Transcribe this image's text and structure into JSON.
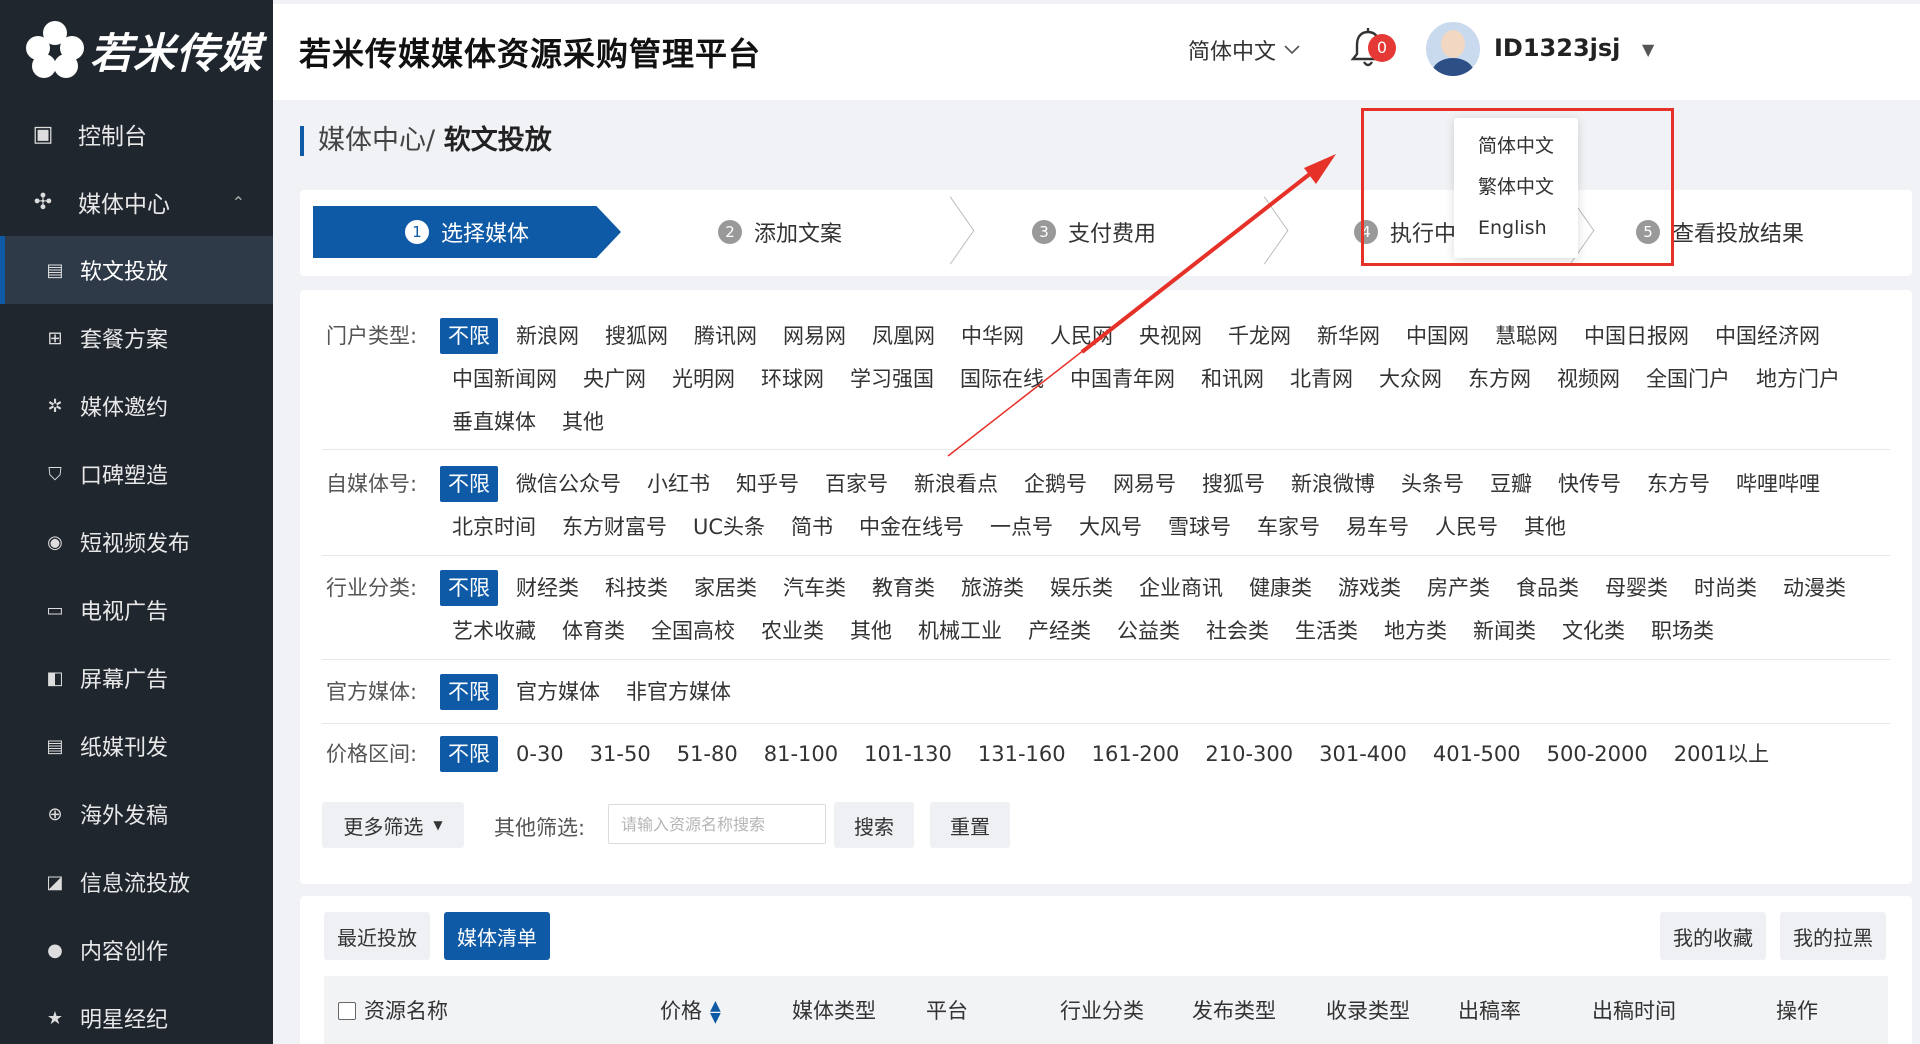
{
  "brand": {
    "logo_text": "若米传媒"
  },
  "sidebar": {
    "items": [
      {
        "label": "控制台",
        "icon": "dashboard-icon",
        "glyph": "▣"
      },
      {
        "label": "媒体中心",
        "icon": "fan-icon",
        "glyph": "✣"
      },
      {
        "label": "软文投放",
        "icon": "doc-icon",
        "glyph": "▤"
      },
      {
        "label": "套餐方案",
        "icon": "grid-icon",
        "glyph": "⊞"
      },
      {
        "label": "媒体邀约",
        "icon": "link-icon",
        "glyph": "✲"
      },
      {
        "label": "口碑塑造",
        "icon": "shield-icon",
        "glyph": "⛉"
      },
      {
        "label": "短视频发布",
        "icon": "play-icon",
        "glyph": "◉"
      },
      {
        "label": "电视广告",
        "icon": "tv-icon",
        "glyph": "▭"
      },
      {
        "label": "屏幕广告",
        "icon": "screen-icon",
        "glyph": "◧"
      },
      {
        "label": "纸媒刊发",
        "icon": "paper-icon",
        "glyph": "▤"
      },
      {
        "label": "海外发稿",
        "icon": "globe-icon",
        "glyph": "⊕"
      },
      {
        "label": "信息流投放",
        "icon": "chart-icon",
        "glyph": "◪"
      },
      {
        "label": "内容创作",
        "icon": "pen-icon",
        "glyph": "●"
      },
      {
        "label": "明星经纪",
        "icon": "star-icon",
        "glyph": "★"
      }
    ]
  },
  "header": {
    "title": "若米传媒媒体资源采购管理平台",
    "language": "简体中文",
    "notification_count": "0",
    "user_id": "ID1323jsj"
  },
  "breadcrumb": {
    "parent": "媒体中心/",
    "current": "软文投放"
  },
  "steps": [
    {
      "num": "1",
      "label": "选择媒体"
    },
    {
      "num": "2",
      "label": "添加文案"
    },
    {
      "num": "3",
      "label": "支付费用"
    },
    {
      "num": "4",
      "label": "执行中"
    },
    {
      "num": "5",
      "label": "查看投放结果"
    }
  ],
  "language_menu": [
    "简体中文",
    "繁体中文",
    "English"
  ],
  "filters": [
    {
      "label": "门户类型:",
      "options": [
        "不限",
        "新浪网",
        "搜狐网",
        "腾讯网",
        "网易网",
        "凤凰网",
        "中华网",
        "人民网",
        "央视网",
        "千龙网",
        "新华网",
        "中国网",
        "慧聪网",
        "中国日报网",
        "中国经济网",
        "中国新闻网",
        "央广网",
        "光明网",
        "环球网",
        "学习强国",
        "国际在线",
        "中国青年网",
        "和讯网",
        "北青网",
        "大众网",
        "东方网",
        "视频网",
        "全国门户",
        "地方门户",
        "垂直媒体",
        "其他"
      ]
    },
    {
      "label": "自媒体号:",
      "options": [
        "不限",
        "微信公众号",
        "小红书",
        "知乎号",
        "百家号",
        "新浪看点",
        "企鹅号",
        "网易号",
        "搜狐号",
        "新浪微博",
        "头条号",
        "豆瓣",
        "快传号",
        "东方号",
        "哔哩哔哩",
        "北京时间",
        "东方财富号",
        "UC头条",
        "简书",
        "中金在线号",
        "一点号",
        "大风号",
        "雪球号",
        "车家号",
        "易车号",
        "人民号",
        "其他"
      ]
    },
    {
      "label": "行业分类:",
      "options": [
        "不限",
        "财经类",
        "科技类",
        "家居类",
        "汽车类",
        "教育类",
        "旅游类",
        "娱乐类",
        "企业商讯",
        "健康类",
        "游戏类",
        "房产类",
        "食品类",
        "母婴类",
        "时尚类",
        "动漫类",
        "艺术收藏",
        "体育类",
        "全国高校",
        "农业类",
        "其他",
        "机械工业",
        "产经类",
        "公益类",
        "社会类",
        "生活类",
        "地方类",
        "新闻类",
        "文化类",
        "职场类"
      ]
    },
    {
      "label": "官方媒体:",
      "options": [
        "不限",
        "官方媒体",
        "非官方媒体"
      ]
    },
    {
      "label": "价格区间:",
      "options": [
        "不限",
        "0-30",
        "31-50",
        "51-80",
        "81-100",
        "101-130",
        "131-160",
        "161-200",
        "210-300",
        "301-400",
        "401-500",
        "500-2000",
        "2001以上"
      ]
    }
  ],
  "filter_actions": {
    "more_label": "更多筛选",
    "other_label": "其他筛选:",
    "search_placeholder": "请输入资源名称搜索",
    "search_button": "搜索",
    "reset_button": "重置"
  },
  "list": {
    "tabs": [
      "最近投放",
      "媒体清单"
    ],
    "right_buttons": [
      "我的收藏",
      "我的拉黑"
    ],
    "columns": [
      "资源名称",
      "价格",
      "媒体类型",
      "平台",
      "行业分类",
      "发布类型",
      "收录类型",
      "出稿率",
      "出稿时间",
      "操作"
    ]
  },
  "colors": {
    "primary": "#0f5aa6",
    "sidebar_bg": "#20262e",
    "highlight": "#e63129",
    "badge": "#e53935"
  }
}
